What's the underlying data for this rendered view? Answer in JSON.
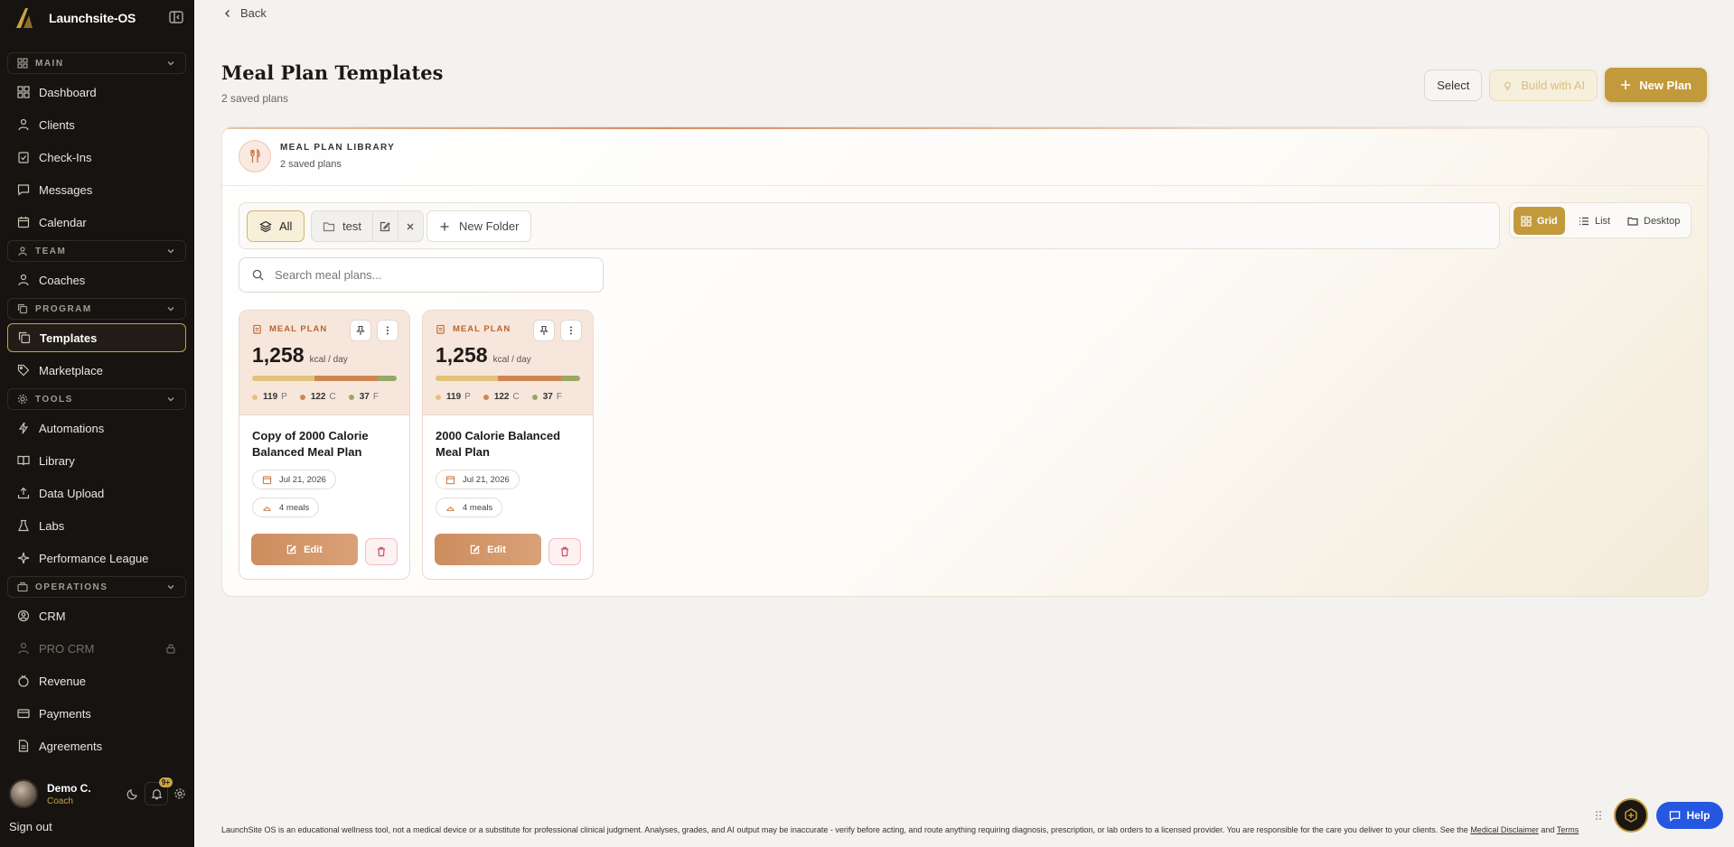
{
  "app": {
    "name": "Launchsite-OS"
  },
  "sidebar": {
    "sections": [
      {
        "label": "MAIN",
        "items": [
          "Dashboard",
          "Clients",
          "Check-Ins",
          "Messages",
          "Calendar"
        ]
      },
      {
        "label": "TEAM",
        "items": [
          "Coaches"
        ]
      },
      {
        "label": "PROGRAM",
        "items": [
          "Templates",
          "Marketplace"
        ]
      },
      {
        "label": "TOOLS",
        "items": [
          "Automations",
          "Library",
          "Data Upload",
          "Labs",
          "Performance League"
        ]
      },
      {
        "label": "OPERATIONS",
        "items": [
          "CRM",
          "PRO CRM",
          "Revenue",
          "Payments",
          "Agreements"
        ]
      }
    ],
    "active_item": "Templates",
    "locked_item": "PRO CRM",
    "profile": {
      "name": "Demo C.",
      "role": "Coach",
      "notifications": "9+"
    },
    "sign_out": "Sign out"
  },
  "header": {
    "back": "Back",
    "title": "Meal Plan Templates",
    "subtitle": "2 saved plans",
    "select": "Select",
    "build_ai": "Build with AI",
    "new_plan": "New Plan"
  },
  "library": {
    "title": "MEAL PLAN LIBRARY",
    "subtitle": "2 saved plans",
    "filter_all": "All",
    "folder_name": "test",
    "new_folder": "New Folder",
    "views": {
      "grid": "Grid",
      "list": "List",
      "desktop": "Desktop",
      "active": "Grid"
    },
    "search_placeholder": "Search meal plans..."
  },
  "cards": [
    {
      "tag": "MEAL PLAN",
      "kcal": "1,258",
      "kcal_unit": "kcal / day",
      "protein": "119",
      "carbs": "122",
      "fat": "37",
      "p_label": "P",
      "c_label": "C",
      "f_label": "F",
      "title": "Copy of 2000 Calorie Balanced Meal Plan",
      "date": "Jul 21, 2026",
      "meals": "4 meals",
      "edit": "Edit"
    },
    {
      "tag": "MEAL PLAN",
      "kcal": "1,258",
      "kcal_unit": "kcal / day",
      "protein": "119",
      "carbs": "122",
      "fat": "37",
      "p_label": "P",
      "c_label": "C",
      "f_label": "F",
      "title": "2000 Calorie Balanced Meal Plan",
      "date": "Jul 21, 2026",
      "meals": "4 meals",
      "edit": "Edit"
    }
  ],
  "footer": {
    "disclaimer_text": "LaunchSite OS is an educational wellness tool, not a medical device or a substitute for professional clinical judgment. Analyses, grades, and AI output may be inaccurate - verify before acting, and route anything requiring diagnosis, prescription, or lab orders to a licensed provider. You are responsible for the care you deliver to your clients. See the",
    "disclaimer_link1": "Medical Disclaimer",
    "disclaimer_and": "and",
    "disclaimer_link2": "Terms",
    "help": "Help"
  },
  "colors": {
    "accent": "#c29a3c",
    "sidebar_bg": "#161310",
    "card_accent": "#cd8d5d"
  }
}
